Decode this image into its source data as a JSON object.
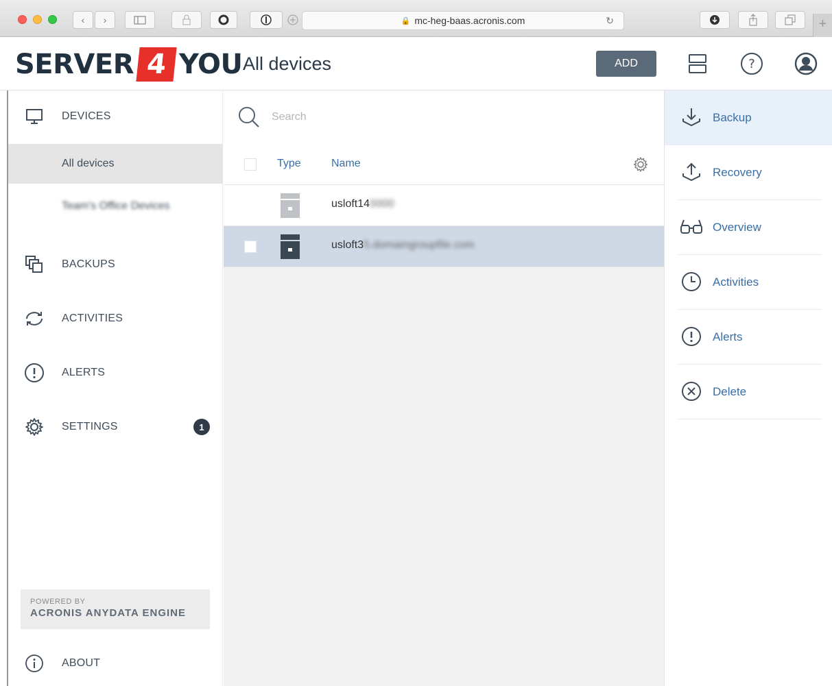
{
  "browser": {
    "url": "mc-heg-baas.acronis.com"
  },
  "header": {
    "logo_left": "SERVER",
    "logo_digit": "4",
    "logo_right": "YOU",
    "title": "All devices",
    "add_label": "ADD"
  },
  "sidebar": {
    "devices_label": "DEVICES",
    "all_devices_label": "All devices",
    "group_label": "Team's Office Devices",
    "backups_label": "BACKUPS",
    "activities_label": "ACTIVITIES",
    "alerts_label": "ALERTS",
    "settings_label": "SETTINGS",
    "settings_badge": "1",
    "powered_by": "POWERED BY",
    "engine": "ACRONIS ANYDATA ENGINE",
    "about_label": "ABOUT"
  },
  "main": {
    "search_placeholder": "Search",
    "columns": {
      "type": "Type",
      "name": "Name"
    },
    "rows": [
      {
        "name_visible": "usloft14",
        "name_blurred": "0000",
        "selected": false
      },
      {
        "name_visible": "usloft3",
        "name_blurred": "5.domaingroupfile.com",
        "selected": true
      }
    ]
  },
  "actions": {
    "backup": "Backup",
    "recovery": "Recovery",
    "overview": "Overview",
    "activities": "Activities",
    "alerts": "Alerts",
    "delete": "Delete"
  },
  "colors": {
    "brand_red": "#e8302b",
    "link_blue": "#3a6ea5",
    "selected_row": "#cfd9e6",
    "active_action": "#e8f1fa"
  }
}
